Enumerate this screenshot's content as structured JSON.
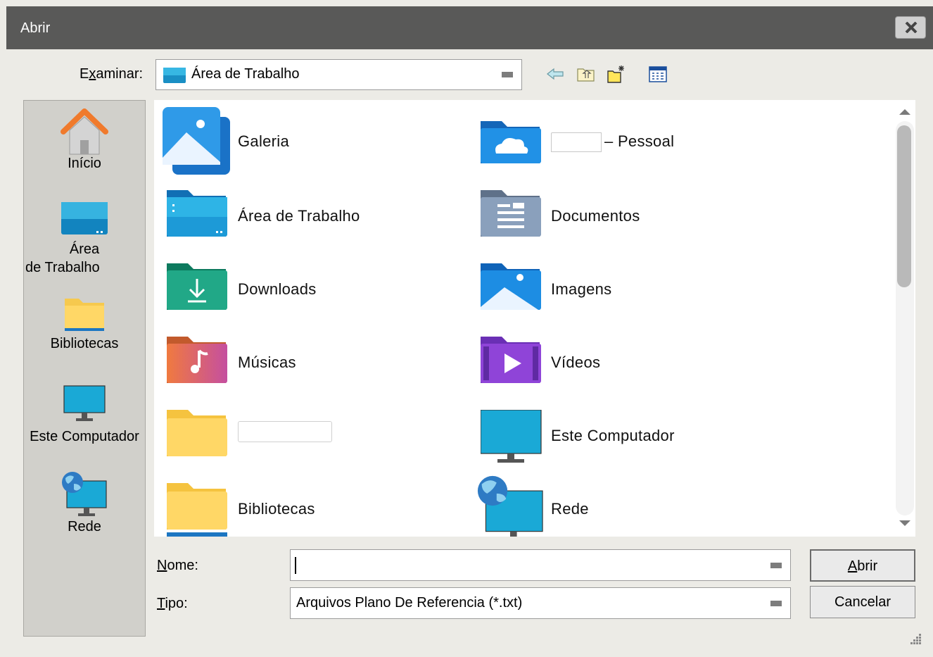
{
  "window": {
    "title": "Abrir"
  },
  "lookin": {
    "label_pre": "E",
    "label_underline": "x",
    "label_post": "aminar:",
    "value": "Área de Trabalho"
  },
  "places": [
    {
      "label": "Início",
      "icon": "home-icon"
    },
    {
      "label_line1": "Área",
      "label_line2": "de Trabalho",
      "icon": "desktop-icon"
    },
    {
      "label": "Bibliotecas",
      "icon": "folder-icon"
    },
    {
      "label": "Este Computador",
      "icon": "monitor-icon"
    },
    {
      "label": "Rede",
      "icon": "network-icon"
    }
  ],
  "files": [
    {
      "label": "Galeria",
      "icon": "gallery-icon"
    },
    {
      "label": "– Pessoal",
      "icon": "onedrive-folder-icon"
    },
    {
      "label": "Área de Trabalho",
      "icon": "desktop-folder-icon"
    },
    {
      "label": "Documentos",
      "icon": "documents-folder-icon"
    },
    {
      "label": "Downloads",
      "icon": "downloads-folder-icon"
    },
    {
      "label": "Imagens",
      "icon": "pictures-folder-icon"
    },
    {
      "label": "Músicas",
      "icon": "music-folder-icon"
    },
    {
      "label": "Vídeos",
      "icon": "videos-folder-icon"
    },
    {
      "label": "",
      "icon": "folder-icon"
    },
    {
      "label": "Este Computador",
      "icon": "monitor-icon"
    },
    {
      "label": "Bibliotecas",
      "icon": "folder-icon"
    },
    {
      "label": "Rede",
      "icon": "network-icon"
    }
  ],
  "form": {
    "nome_label_u": "N",
    "nome_label_rest": "ome:",
    "nome_value": "",
    "tipo_label_u": "T",
    "tipo_label_rest": "ipo:",
    "tipo_value": "Arquivos Plano De Referencia (*.txt)"
  },
  "buttons": {
    "open_u": "A",
    "open_rest": "brir",
    "cancel": "Cancelar"
  }
}
